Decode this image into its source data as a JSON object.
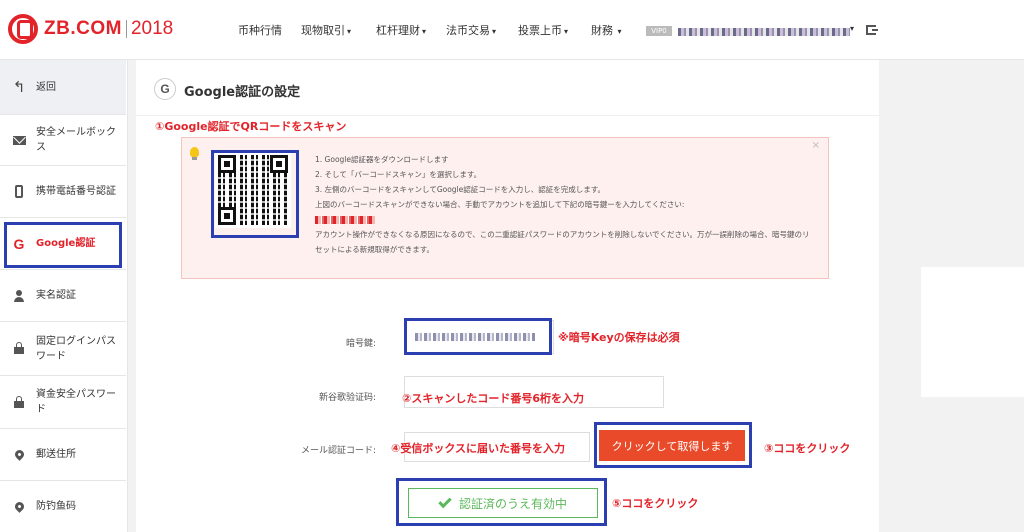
{
  "header": {
    "logo_text": "ZB.COM",
    "logo_year": "2018",
    "nav": [
      "币种行情",
      "现物取引",
      "杠杆理财",
      "法币交易",
      "投票上币",
      "財務"
    ],
    "vip_badge": "VIP0"
  },
  "sidebar": {
    "items": [
      {
        "label": "返回",
        "icon": "back-arrow-icon"
      },
      {
        "label": "安全メールボックス",
        "icon": "mail-icon"
      },
      {
        "label": "携带電話番号認証",
        "icon": "phone-icon"
      },
      {
        "label": "Google認証",
        "icon": "google-icon",
        "icon_glyph": "G"
      },
      {
        "label": "実名認証",
        "icon": "user-icon"
      },
      {
        "label": "固定ログインパスワード",
        "icon": "lock-icon"
      },
      {
        "label": "資金安全パスワード",
        "icon": "lock-icon"
      },
      {
        "label": "郵送住所",
        "icon": "location-pin-icon"
      },
      {
        "label": "防钓鱼码",
        "icon": "location-pin-icon"
      }
    ]
  },
  "main": {
    "title_icon": "G",
    "title": "Google認証の設定",
    "step1": "①Google認証でQRコードをスキャン",
    "info": {
      "line1": "1. Google認証器をダウンロードします",
      "line2": "2. そして「バーコードスキャン」を選択します。",
      "line3": "3. 左側のバーコードをスキャンしてGoogle認証コードを入力し、認証を完成します。",
      "line4": "上図のバーコードスキャンができない場合、手動でアカウントを追加して下記の暗号鍵ーを入力してください:",
      "warning": "アカウント操作ができなくなる原因になるので、この二重認証パスワードのアカウントを削除しないでください。万が一誤削除の場合、暗号鍵のリセットによる新規取得ができます。",
      "close": "×"
    },
    "form": {
      "key_label": "暗号鍵:",
      "key_note": "※暗号Keyの保存は必須",
      "code_label": "新谷歌验证码:",
      "code_note": "②スキャンしたコード番号6桁を入力",
      "email_label": "メール認証コード:",
      "email_note": "④受信ボックスに届いた番号を入力",
      "get_button": "クリックして取得します",
      "get_note": "③ココをクリック",
      "verify_button": "認証済のうえ有効中",
      "verify_note": "⑤ココをクリック"
    }
  },
  "colors": {
    "brand_red": "#e2232a",
    "highlight_blue": "#2b3fb0",
    "button_orange": "#e94b2a",
    "success_green": "#5cb85c"
  }
}
